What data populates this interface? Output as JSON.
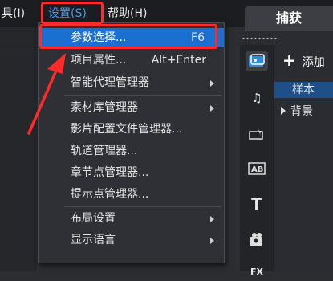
{
  "menubar": {
    "items": [
      {
        "label": "具(I)"
      },
      {
        "label": "设置(S)",
        "selected": true
      },
      {
        "label": "帮助(H)"
      }
    ]
  },
  "dropdown": {
    "groups": [
      [
        {
          "label": "参数选择...",
          "shortcut": "F6",
          "highlighted": true
        },
        {
          "label": "项目属性...",
          "shortcut": "Alt+Enter"
        },
        {
          "label": "智能代理管理器",
          "submenu": true
        }
      ],
      [
        {
          "label": "素材库管理器",
          "submenu": true
        },
        {
          "label": "影片配置文件管理器..."
        },
        {
          "label": "轨道管理器..."
        },
        {
          "label": "章节点管理器..."
        },
        {
          "label": "提示点管理器..."
        }
      ],
      [
        {
          "label": "布局设置",
          "submenu": true
        },
        {
          "label": "显示语言",
          "submenu": true
        }
      ]
    ]
  },
  "right_panel": {
    "tab_label": "捕获",
    "add_label": "添加",
    "library_items": [
      {
        "label": "样本",
        "selected": true
      },
      {
        "label": "背景",
        "expandable": true
      }
    ],
    "icons": [
      "media-icon",
      "audio-icon",
      "transition-icon",
      "title-ab-icon",
      "text-icon",
      "filter-icon",
      "fx-icon"
    ]
  },
  "colors": {
    "accent_blue": "#1b6fd0",
    "annotation_red": "#ff2a2a",
    "menubar_selected": "#3e9cf5"
  }
}
